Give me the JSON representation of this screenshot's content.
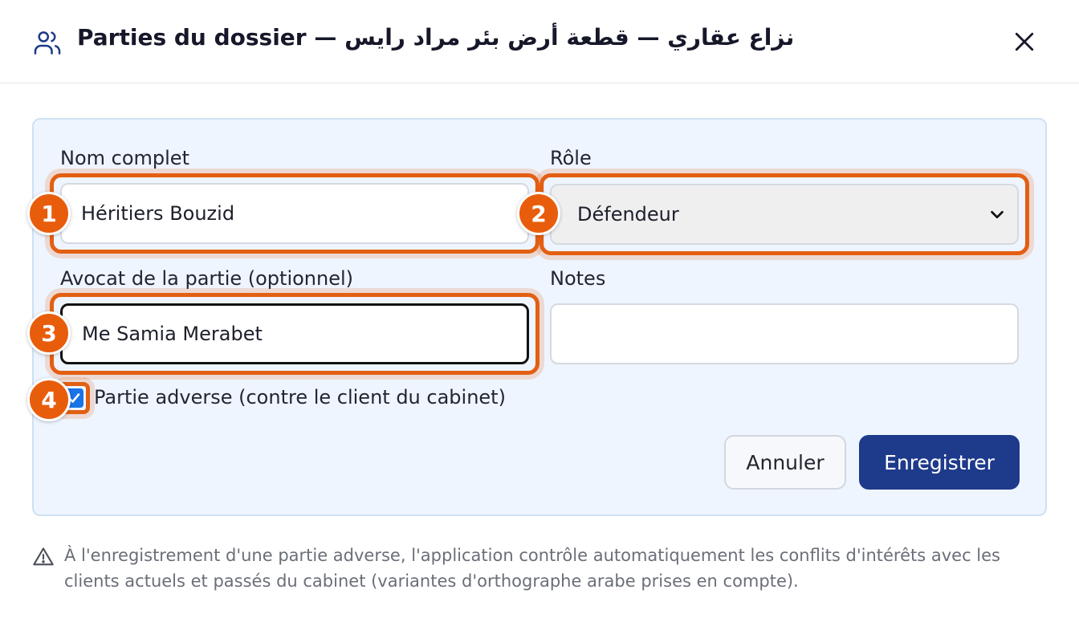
{
  "dialog": {
    "title": "Parties du dossier — نزاع عقاري — قطعة أرض بئر مراد رايس",
    "title_icon": "users-icon",
    "close_icon": "close-icon"
  },
  "form": {
    "nom_complet": {
      "label": "Nom complet",
      "value": "Héritiers Bouzid"
    },
    "role": {
      "label": "Rôle",
      "value": "Défendeur"
    },
    "avocat": {
      "label": "Avocat de la partie (optionnel)",
      "value": "Me Samia Merabet"
    },
    "notes": {
      "label": "Notes",
      "value": ""
    },
    "partie_adverse": {
      "label": "Partie adverse (contre le client du cabinet)",
      "checked": true
    }
  },
  "buttons": {
    "cancel": "Annuler",
    "save": "Enregistrer"
  },
  "badges": [
    "1",
    "2",
    "3",
    "4"
  ],
  "footnote": "À l'enregistrement d'une partie adverse, l'application contrôle automatiquement les conflits d'intérêts avec les clients actuels et passés du cabinet (variantes d'orthographe arabe prises en compte).",
  "colors": {
    "accent": "#1e3a8a",
    "highlight": "#e35f12",
    "checkbox": "#1a73e8",
    "panel_bg": "#eef5fe"
  }
}
